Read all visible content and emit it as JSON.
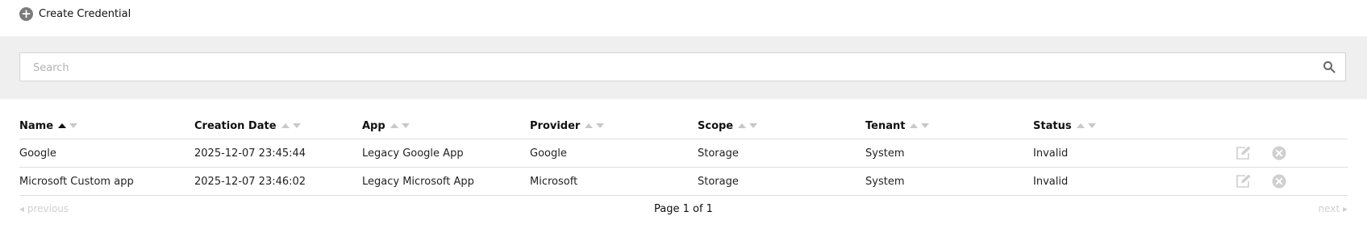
{
  "toolbar": {
    "create_label": "Create Credential"
  },
  "search": {
    "placeholder": "Search",
    "value": ""
  },
  "table": {
    "columns": [
      "Name",
      "Creation Date",
      "App",
      "Provider",
      "Scope",
      "Tenant",
      "Status"
    ],
    "sort": {
      "column": "Name",
      "direction": "ascending"
    },
    "rows": [
      {
        "name": "Google",
        "creation_date": "2025-12-07 23:45:44",
        "app": "Legacy Google App",
        "provider": "Google",
        "scope": "Storage",
        "tenant": "System",
        "status": "Invalid"
      },
      {
        "name": "Microsoft Custom app",
        "creation_date": "2025-12-07 23:46:02",
        "app": "Legacy Microsoft App",
        "provider": "Microsoft",
        "scope": "Storage",
        "tenant": "System",
        "status": "Invalid"
      }
    ]
  },
  "pagination": {
    "previous_label": "previous",
    "page_label": "Page 1 of 1",
    "next_label": "next"
  },
  "colors": {
    "invalid": "#e02020",
    "search_band": "#efefef"
  },
  "icons": {
    "create": "plus-circle-icon",
    "search": "search-icon",
    "edit": "edit-icon",
    "delete": "close-circle-icon"
  }
}
